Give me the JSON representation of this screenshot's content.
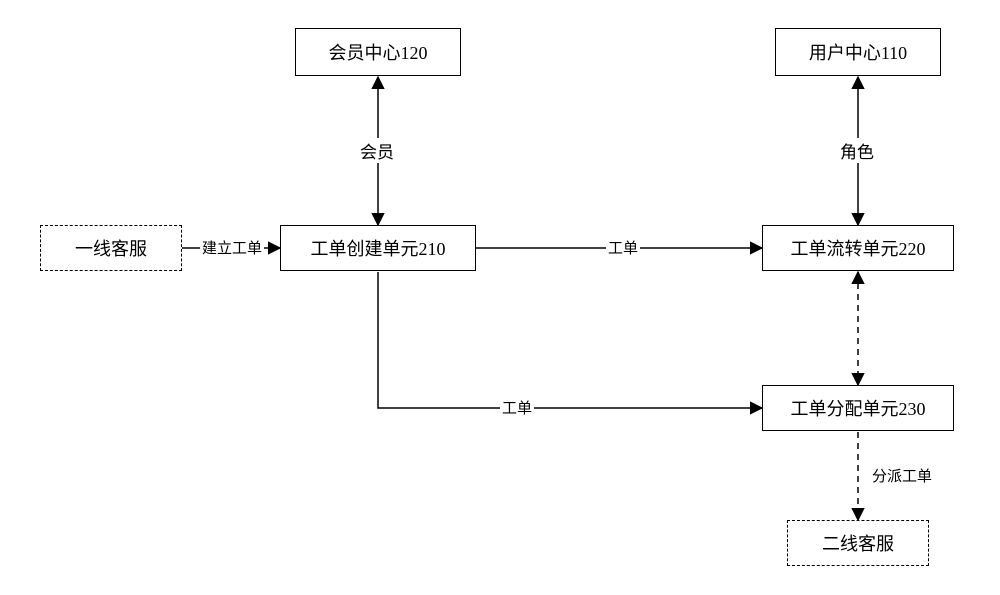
{
  "nodes": {
    "member_center": "会员中心120",
    "user_center": "用户中心110",
    "frontline_service": "一线客服",
    "create_unit": "工单创建单元210",
    "flow_unit": "工单流转单元220",
    "assign_unit": "工单分配单元230",
    "secondline_service": "二线客服"
  },
  "edges": {
    "create_ticket": "建立工单",
    "member": "会员",
    "role": "角色",
    "ticket1": "工单",
    "ticket2": "工单",
    "dispatch_ticket": "分派工单"
  }
}
